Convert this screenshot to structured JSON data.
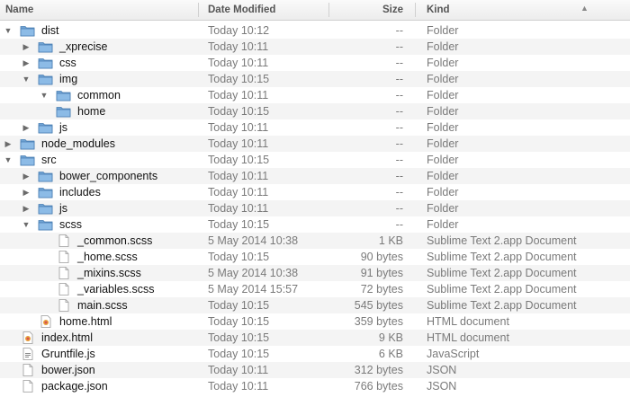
{
  "header": {
    "name": "Name",
    "date": "Date Modified",
    "size": "Size",
    "kind": "Kind"
  },
  "colors": {
    "folder": "#6fa3d4",
    "stripe": "#f4f4f4"
  },
  "rows": [
    {
      "name": "dist",
      "depth": 0,
      "type": "folder",
      "expand": "open",
      "date": "Today 10:12",
      "size": "--",
      "kind": "Folder"
    },
    {
      "name": "_xprecise",
      "depth": 1,
      "type": "folder",
      "expand": "closed",
      "date": "Today 10:11",
      "size": "--",
      "kind": "Folder"
    },
    {
      "name": "css",
      "depth": 1,
      "type": "folder",
      "expand": "closed",
      "date": "Today 10:11",
      "size": "--",
      "kind": "Folder"
    },
    {
      "name": "img",
      "depth": 1,
      "type": "folder",
      "expand": "open",
      "date": "Today 10:15",
      "size": "--",
      "kind": "Folder"
    },
    {
      "name": "common",
      "depth": 2,
      "type": "folder",
      "expand": "open",
      "date": "Today 10:11",
      "size": "--",
      "kind": "Folder"
    },
    {
      "name": "home",
      "depth": 2,
      "type": "folder",
      "expand": "none",
      "date": "Today 10:15",
      "size": "--",
      "kind": "Folder"
    },
    {
      "name": "js",
      "depth": 1,
      "type": "folder",
      "expand": "closed",
      "date": "Today 10:11",
      "size": "--",
      "kind": "Folder"
    },
    {
      "name": "node_modules",
      "depth": 0,
      "type": "folder",
      "expand": "closed",
      "date": "Today 10:11",
      "size": "--",
      "kind": "Folder"
    },
    {
      "name": "src",
      "depth": 0,
      "type": "folder",
      "expand": "open",
      "date": "Today 10:15",
      "size": "--",
      "kind": "Folder"
    },
    {
      "name": "bower_components",
      "depth": 1,
      "type": "folder",
      "expand": "closed",
      "date": "Today 10:11",
      "size": "--",
      "kind": "Folder"
    },
    {
      "name": "includes",
      "depth": 1,
      "type": "folder",
      "expand": "closed",
      "date": "Today 10:11",
      "size": "--",
      "kind": "Folder"
    },
    {
      "name": "js",
      "depth": 1,
      "type": "folder",
      "expand": "closed",
      "date": "Today 10:11",
      "size": "--",
      "kind": "Folder"
    },
    {
      "name": "scss",
      "depth": 1,
      "type": "folder",
      "expand": "open",
      "date": "Today 10:15",
      "size": "--",
      "kind": "Folder"
    },
    {
      "name": "_common.scss",
      "depth": 2,
      "type": "doc",
      "expand": "none",
      "date": "5 May 2014 10:38",
      "size": "1 KB",
      "kind": "Sublime Text 2.app Document"
    },
    {
      "name": "_home.scss",
      "depth": 2,
      "type": "doc",
      "expand": "none",
      "date": "Today 10:15",
      "size": "90 bytes",
      "kind": "Sublime Text 2.app Document"
    },
    {
      "name": "_mixins.scss",
      "depth": 2,
      "type": "doc",
      "expand": "none",
      "date": "5 May 2014 10:38",
      "size": "91 bytes",
      "kind": "Sublime Text 2.app Document"
    },
    {
      "name": "_variables.scss",
      "depth": 2,
      "type": "doc",
      "expand": "none",
      "date": "5 May 2014 15:57",
      "size": "72 bytes",
      "kind": "Sublime Text 2.app Document"
    },
    {
      "name": "main.scss",
      "depth": 2,
      "type": "doc",
      "expand": "none",
      "date": "Today 10:15",
      "size": "545 bytes",
      "kind": "Sublime Text 2.app Document"
    },
    {
      "name": "home.html",
      "depth": 1,
      "type": "html",
      "expand": "none",
      "date": "Today 10:15",
      "size": "359 bytes",
      "kind": "HTML document"
    },
    {
      "name": "index.html",
      "depth": 0,
      "type": "html",
      "expand": "none",
      "date": "Today 10:15",
      "size": "9 KB",
      "kind": "HTML document"
    },
    {
      "name": "Gruntfile.js",
      "depth": 0,
      "type": "js",
      "expand": "none",
      "date": "Today 10:15",
      "size": "6 KB",
      "kind": "JavaScript"
    },
    {
      "name": "bower.json",
      "depth": 0,
      "type": "doc",
      "expand": "none",
      "date": "Today 10:11",
      "size": "312 bytes",
      "kind": "JSON"
    },
    {
      "name": "package.json",
      "depth": 0,
      "type": "doc",
      "expand": "none",
      "date": "Today 10:11",
      "size": "766 bytes",
      "kind": "JSON"
    }
  ]
}
